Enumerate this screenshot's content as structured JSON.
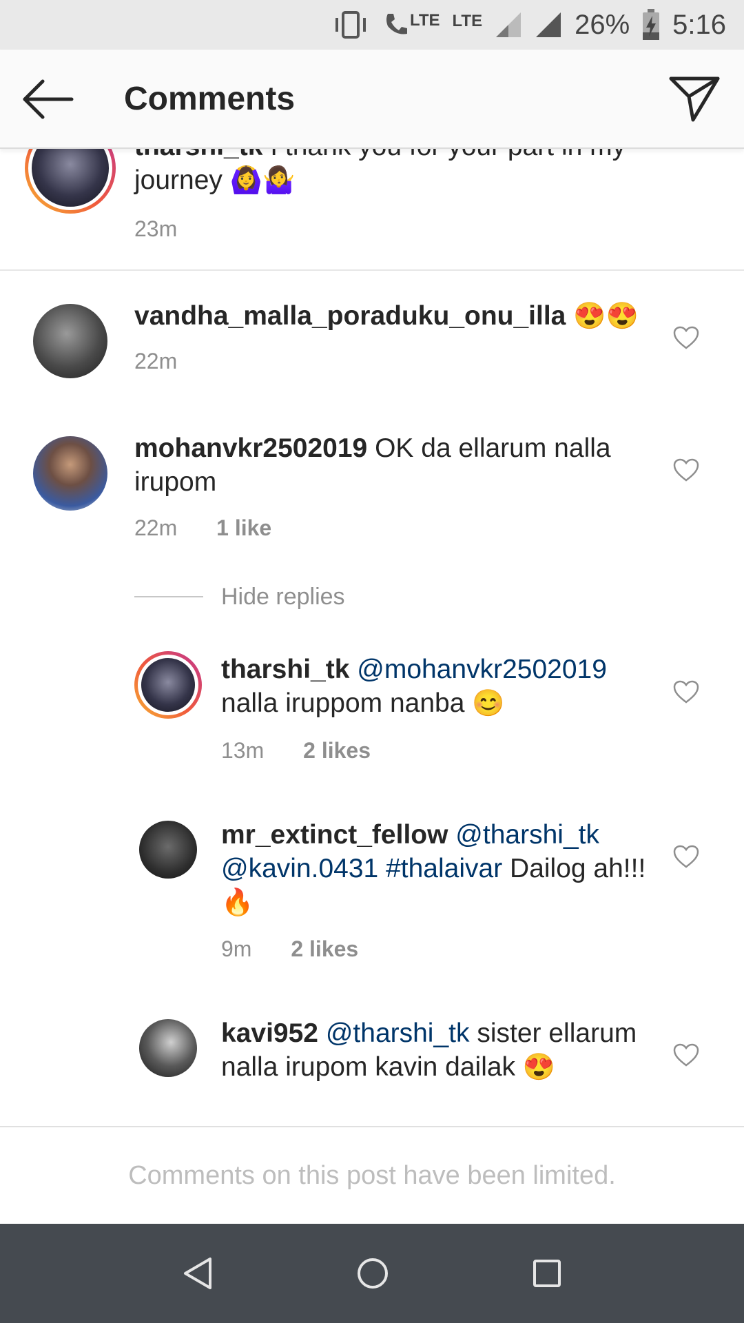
{
  "status_bar": {
    "lte1": "LTE",
    "lte2": "LTE",
    "battery": "26%",
    "time": "5:16"
  },
  "header": {
    "title": "Comments",
    "back_icon": "arrow-left-icon",
    "send_icon": "paper-plane-icon"
  },
  "comments": [
    {
      "user": "tharshi_tk",
      "text": "I thank you for your part in my journey",
      "emoji": "🙆‍♀️🤷‍♀️",
      "time": "23m"
    },
    {
      "user": "vandha_malla_poraduku_onu_illa",
      "text": "",
      "emoji": "😍😍",
      "time": "22m"
    },
    {
      "user": "mohanvkr2502019",
      "text": "OK da ellarum nalla irupom",
      "time": "22m",
      "likes": "1 like"
    }
  ],
  "hide_replies": "Hide replies",
  "replies": [
    {
      "user": "tharshi_tk",
      "mention": "@mohanvkr2502019",
      "text": "nalla iruppom nanba",
      "emoji": "😊",
      "time": "13m",
      "likes": "2 likes"
    },
    {
      "user": "mr_extinct_fellow",
      "mention": "@tharshi_tk",
      "mention2": "@kavin.0431",
      "hashtag": "#thalaivar",
      "text": "Dailog ah!!!",
      "emoji": "🔥",
      "time": "9m",
      "likes": "2 likes"
    },
    {
      "user": "kavi952",
      "mention": "@tharshi_tk",
      "text": "sister ellarum nalla irupom kavin dailak",
      "emoji": "😍"
    }
  ],
  "footer": {
    "limited_text": "Comments on this post have been limited."
  },
  "nav": {
    "back": "triangle-back-icon",
    "home": "circle-home-icon",
    "recents": "square-recents-icon"
  }
}
